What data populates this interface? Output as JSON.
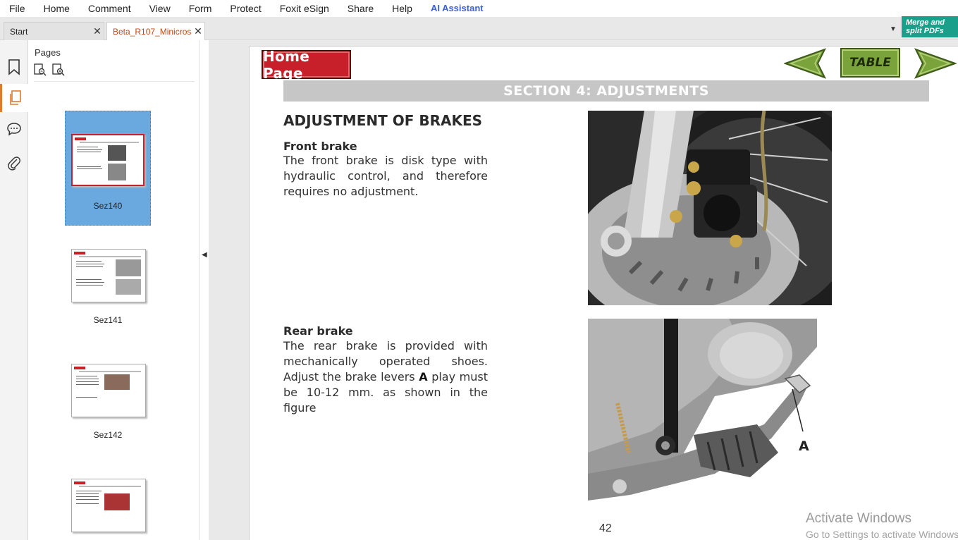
{
  "menu": [
    "File",
    "Home",
    "Comment",
    "View",
    "Form",
    "Protect",
    "Foxit eSign",
    "Share",
    "Help"
  ],
  "menu_ai": "AI Assistant",
  "tabs": {
    "start": "Start",
    "doc": "Beta_R107_Minicross...",
    "close_glyph": "✕"
  },
  "merge_button": "Merge and split PDFs",
  "panel": {
    "title": "Pages",
    "thumbnails": [
      "Sez140",
      "Sez141",
      "Sez142"
    ]
  },
  "page": {
    "home_button": "Home Page",
    "table_button": "TABLE",
    "section_title": "SECTION 4: ADJUSTMENTS",
    "heading": "ADJUSTMENT OF BRAKES",
    "front": {
      "title": "Front brake",
      "text": "The front brake is disk type with hydraulic control, and therefore requires no adjustment."
    },
    "rear": {
      "title": "Rear brake",
      "text1": "The rear brake is provided with mechanically operated shoes.",
      "text2a": "Adjust the brake levers ",
      "text2b": "A",
      "text2c": " play must be 10-12 mm. as shown in the figure"
    },
    "figure_label": "A",
    "page_number": "42"
  },
  "watermark": {
    "line1": "Activate Windows",
    "line2": "Go to Settings to activate Windows."
  },
  "colors": {
    "accent": "#e07b2a",
    "merge": "#1aa08a",
    "home_red": "#c8202a",
    "nav_green": "#7aa33c",
    "selected_thumb": "#6aa9e0"
  }
}
